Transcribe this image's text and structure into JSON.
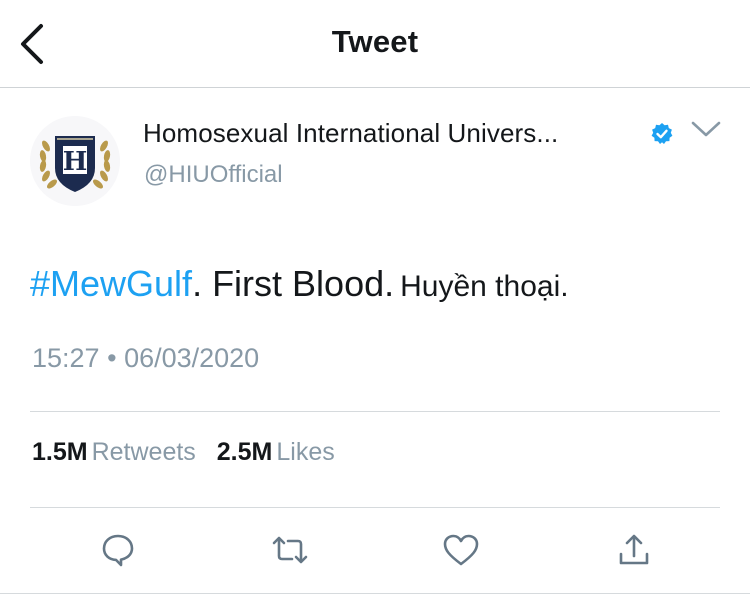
{
  "header": {
    "title": "Tweet",
    "back_icon": "chevron-left-icon"
  },
  "author": {
    "display_name": "Homosexual International Univers...",
    "handle": "@HIUOfficial",
    "verified": true,
    "avatar_letter": "H",
    "avatar_icon": "university-crest-avatar",
    "menu_icon": "chevron-down-icon"
  },
  "tweet": {
    "hashtag": "#MewGulf",
    "text": ". First Blood.",
    "tail": "Huyền thoại.",
    "time": "15:27",
    "separator": "•",
    "date": "06/03/2020"
  },
  "stats": {
    "retweets_count": "1.5M",
    "retweets_label": "Retweets",
    "likes_count": "2.5M",
    "likes_label": "Likes"
  },
  "actions": {
    "reply_icon": "reply-icon",
    "retweet_icon": "retweet-icon",
    "like_icon": "heart-icon",
    "share_icon": "share-icon"
  },
  "colors": {
    "accent": "#1da1f2",
    "secondary_text": "#8899a6",
    "primary_text": "#14171a",
    "crest_navy": "#1c2b4f",
    "laurel_gold": "#b99a4b"
  }
}
